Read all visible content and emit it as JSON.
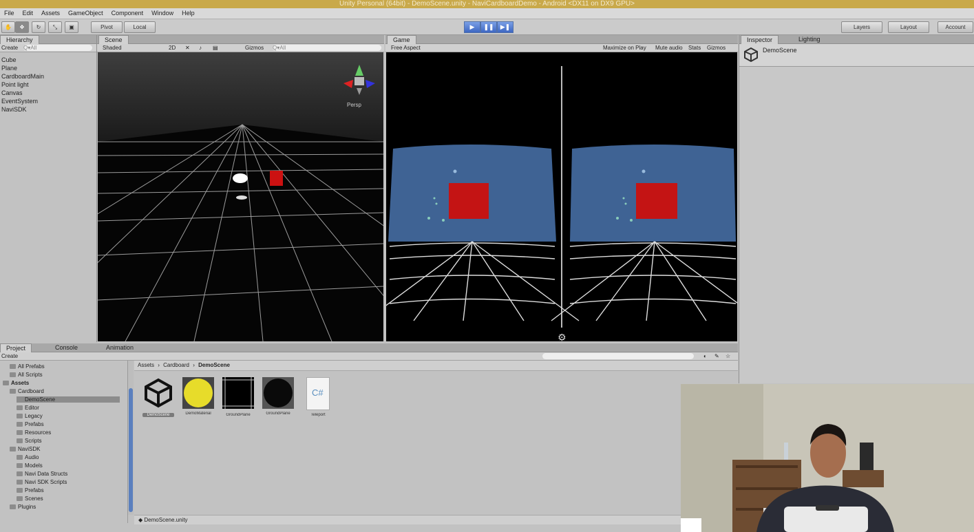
{
  "window": {
    "title": "Unity Personal (64bit) - DemoScene.unity - NaviCardboardDemo - Android <DX11 on DX9 GPU>"
  },
  "menu": [
    "File",
    "Edit",
    "Assets",
    "GameObject",
    "Component",
    "Window",
    "Help"
  ],
  "toolbar": {
    "pivot": "Pivot",
    "local": "Local",
    "layers": "Layers",
    "layout": "Layout",
    "account": "Account"
  },
  "hierarchy": {
    "tab": "Hierarchy",
    "create": "Create",
    "search": "Q▾All",
    "items": [
      "Cube",
      "Plane",
      "CardboardMain",
      "Point light",
      "Canvas",
      "EventSystem",
      "NaviSDK"
    ]
  },
  "scene": {
    "tab": "Scene",
    "shading": "Shaded",
    "mode2d": "2D",
    "gizmos": "Gizmos",
    "search": "Q▾All",
    "persp": "Persp"
  },
  "game": {
    "tab": "Game",
    "aspect": "Free Aspect",
    "maximize": "Maximize on Play",
    "mute": "Mute audio",
    "stats": "Stats",
    "gizmos": "Gizmos"
  },
  "inspector": {
    "tab": "Inspector",
    "lighting_tab": "Lighting",
    "object_name": "DemoScene"
  },
  "project": {
    "tabs": [
      "Project",
      "Console",
      "Animation"
    ],
    "create": "Create",
    "breadcrumb": [
      "Assets",
      "Cardboard",
      "DemoScene"
    ],
    "tree": [
      {
        "label": "All Prefabs",
        "indent": 1
      },
      {
        "label": "All Scripts",
        "indent": 1
      },
      {
        "label": "Assets",
        "indent": 0
      },
      {
        "label": "Cardboard",
        "indent": 1
      },
      {
        "label": "DemoScene",
        "indent": 2
      },
      {
        "label": "Editor",
        "indent": 2
      },
      {
        "label": "Legacy",
        "indent": 2
      },
      {
        "label": "Prefabs",
        "indent": 2
      },
      {
        "label": "Resources",
        "indent": 2
      },
      {
        "label": "Scripts",
        "indent": 2
      },
      {
        "label": "NaviSDK",
        "indent": 1
      },
      {
        "label": "Audio",
        "indent": 2
      },
      {
        "label": "Models",
        "indent": 2
      },
      {
        "label": "Navi Data Structs",
        "indent": 2
      },
      {
        "label": "Navi SDK Scripts",
        "indent": 2
      },
      {
        "label": "Prefabs",
        "indent": 2
      },
      {
        "label": "Scenes",
        "indent": 2
      },
      {
        "label": "Plugins",
        "indent": 1
      }
    ],
    "assets": [
      {
        "label": "DemoScene",
        "kind": "unity"
      },
      {
        "label": "DemoMaterial",
        "kind": "yellow"
      },
      {
        "label": "GroundPlane",
        "kind": "grid"
      },
      {
        "label": "GroundPlane",
        "kind": "dark"
      },
      {
        "label": "Teleport",
        "kind": "cs"
      }
    ],
    "status_file": "DemoScene.unity",
    "cs_glyph": "C#"
  },
  "icons": [
    "hand-tool-icon",
    "move-tool-icon",
    "rotate-tool-icon",
    "scale-tool-icon",
    "rect-tool-icon",
    "play-icon",
    "pause-icon",
    "step-icon",
    "settings-gear-icon",
    "unity-logo-icon"
  ]
}
